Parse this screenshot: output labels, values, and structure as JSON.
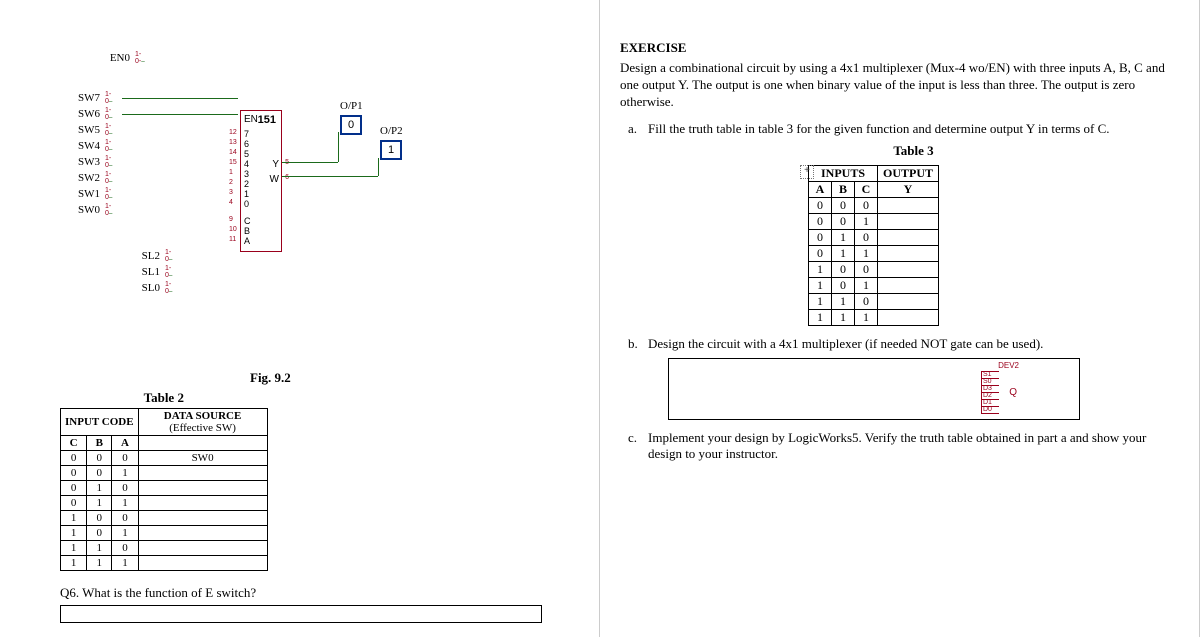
{
  "left_page": {
    "switches_en": "EN0",
    "switches": [
      "SW7",
      "SW6",
      "SW5",
      "SW4",
      "SW3",
      "SW2",
      "SW1",
      "SW0"
    ],
    "sel_switches": [
      "SL2",
      "SL1",
      "SL0"
    ],
    "sw_levels": [
      "1",
      "0"
    ],
    "chip": {
      "name": "151",
      "en_label": "EN",
      "data_pins": [
        "7",
        "6",
        "5",
        "4",
        "3",
        "2",
        "1",
        "0"
      ],
      "data_pin_nums": [
        "12",
        "13",
        "14",
        "15",
        "1",
        "2",
        "3",
        "4"
      ],
      "sel_pins": [
        "C",
        "B",
        "A"
      ],
      "sel_pin_nums": [
        "9",
        "10",
        "11"
      ],
      "out_y": "Y",
      "out_w": "W",
      "out_y_num": "5",
      "out_w_num": "6"
    },
    "outputs": {
      "op1_label": "O/P1",
      "op1_value": "0",
      "op2_label": "O/P2",
      "op2_value": "1"
    },
    "fig_caption": "Fig. 9.2",
    "table2": {
      "title": "Table 2",
      "headers": [
        "INPUT CODE",
        "DATA SOURCE"
      ],
      "subheader": "(Effective SW)",
      "cols": [
        "C",
        "B",
        "A"
      ],
      "rows": [
        {
          "c": "0",
          "b": "0",
          "a": "0",
          "d": "SW0"
        },
        {
          "c": "0",
          "b": "0",
          "a": "1",
          "d": ""
        },
        {
          "c": "0",
          "b": "1",
          "a": "0",
          "d": ""
        },
        {
          "c": "0",
          "b": "1",
          "a": "1",
          "d": ""
        },
        {
          "c": "1",
          "b": "0",
          "a": "0",
          "d": ""
        },
        {
          "c": "1",
          "b": "0",
          "a": "1",
          "d": ""
        },
        {
          "c": "1",
          "b": "1",
          "a": "0",
          "d": ""
        },
        {
          "c": "1",
          "b": "1",
          "a": "1",
          "d": ""
        }
      ]
    },
    "q6": "Q6. What is the function of E switch?"
  },
  "right_page": {
    "title": "EXERCISE",
    "desc": "Design a combinational circuit by using a 4x1 multiplexer (Mux-4 wo/EN) with three inputs A, B, C and one output Y. The output is one when binary value of the input is less than three. The output is zero otherwise.",
    "items": {
      "a": "Fill the truth table in table 3 for the given function and determine output Y in terms of C.",
      "b": "Design the circuit with a 4x1 multiplexer (if needed NOT gate can be used).",
      "c": "Implement your design by LogicWorks5. Verify the truth table obtained in part a and show your design to your instructor."
    },
    "table3": {
      "title": "Table 3",
      "inputs_label": "INPUTS",
      "output_label": "OUTPUT",
      "cols": [
        "A",
        "B",
        "C"
      ],
      "out_col": "Y",
      "rows": [
        {
          "a": "0",
          "b": "0",
          "c": "0",
          "y": ""
        },
        {
          "a": "0",
          "b": "0",
          "c": "1",
          "y": ""
        },
        {
          "a": "0",
          "b": "1",
          "c": "0",
          "y": ""
        },
        {
          "a": "0",
          "b": "1",
          "c": "1",
          "y": ""
        },
        {
          "a": "1",
          "b": "0",
          "c": "0",
          "y": ""
        },
        {
          "a": "1",
          "b": "0",
          "c": "1",
          "y": ""
        },
        {
          "a": "1",
          "b": "1",
          "c": "0",
          "y": ""
        },
        {
          "a": "1",
          "b": "1",
          "c": "1",
          "y": ""
        }
      ]
    },
    "logicworks": {
      "dev_label": "DEV2",
      "sel_pins": [
        "S1",
        "S0"
      ],
      "data_pins": [
        "D3",
        "D2",
        "D1",
        "D0"
      ],
      "out": "Q"
    }
  }
}
